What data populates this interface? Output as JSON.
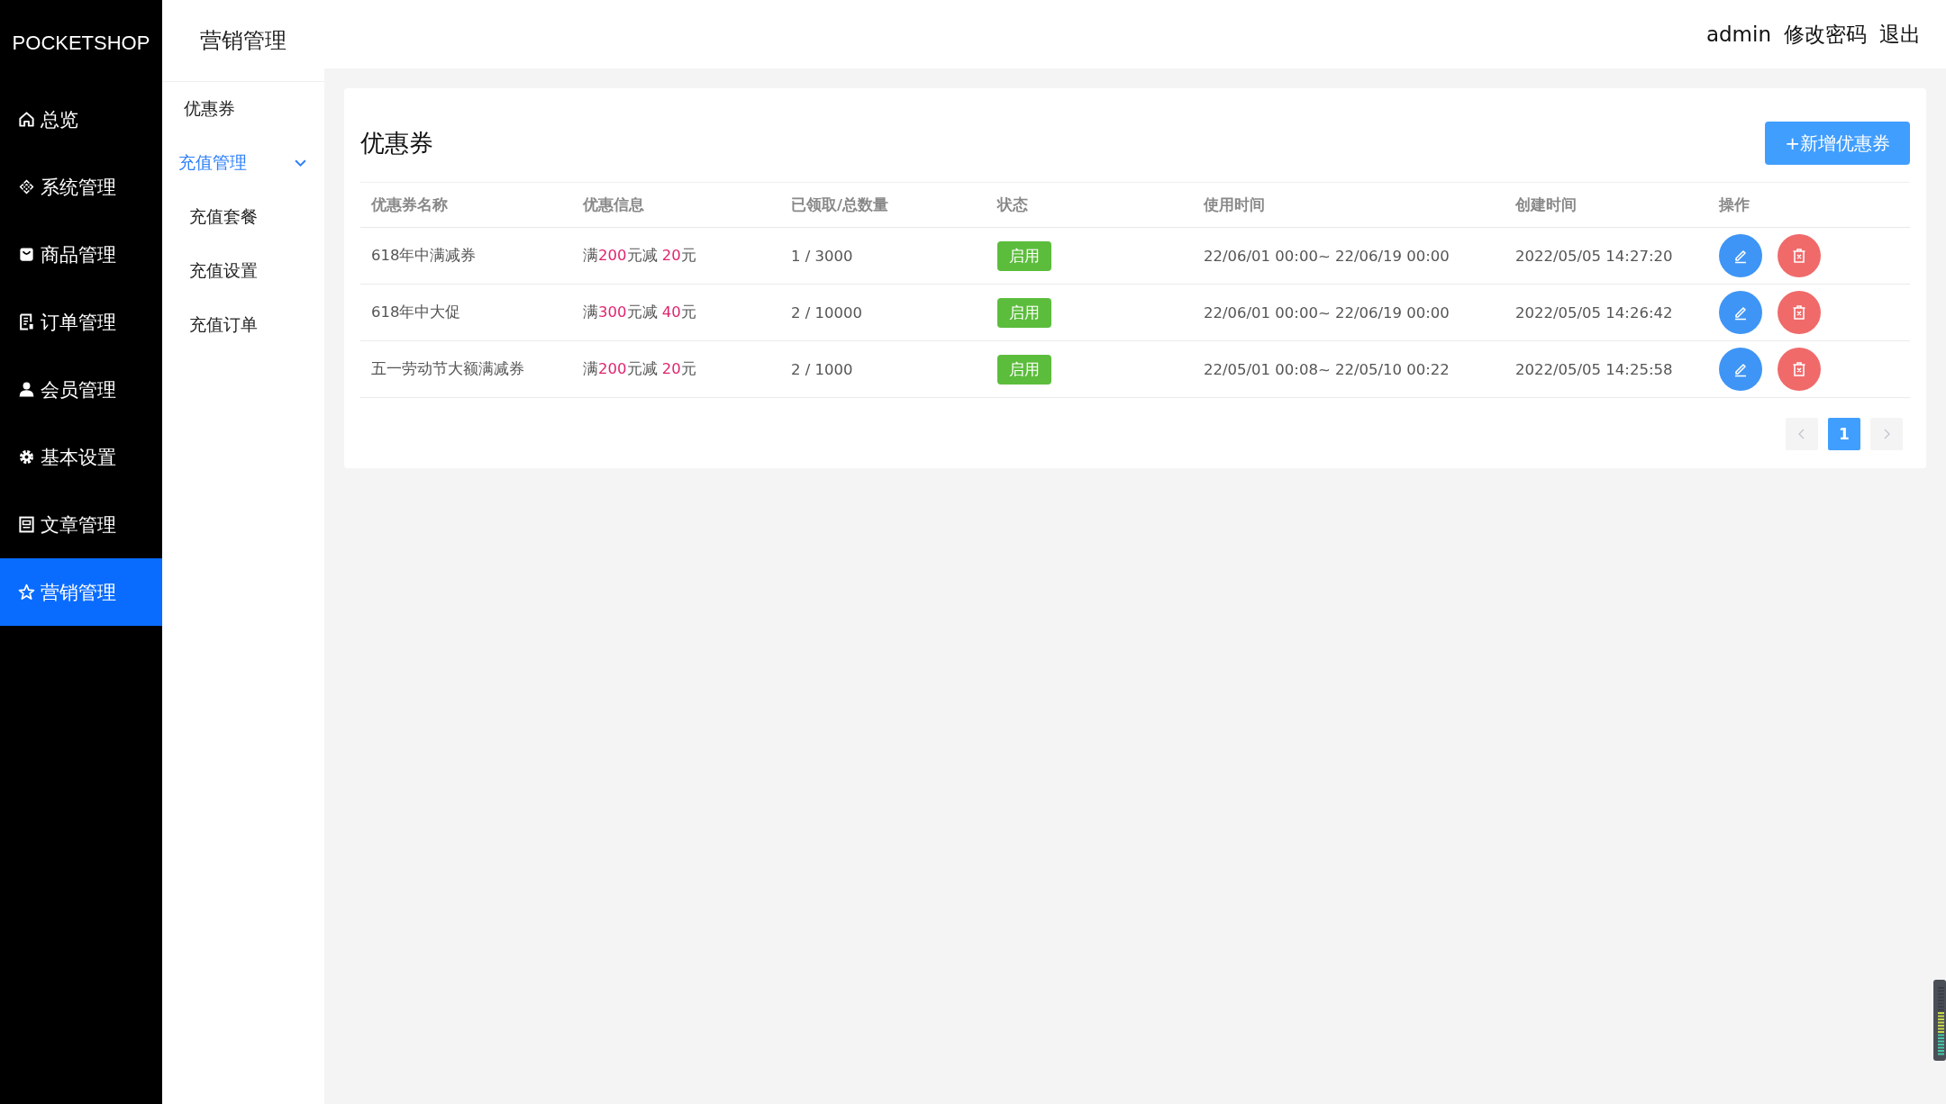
{
  "brand": "POCKETSHOP",
  "nav": [
    {
      "label": "总览",
      "selected": false
    },
    {
      "label": "系统管理",
      "selected": false
    },
    {
      "label": "商品管理",
      "selected": false
    },
    {
      "label": "订单管理",
      "selected": false
    },
    {
      "label": "会员管理",
      "selected": false
    },
    {
      "label": "基本设置",
      "selected": false
    },
    {
      "label": "文章管理",
      "selected": false
    },
    {
      "label": "营销管理",
      "selected": true
    }
  ],
  "submenu": {
    "title": "营销管理",
    "items": [
      {
        "label": "优惠券",
        "selected": false
      },
      {
        "label": "充值管理",
        "expanded": true,
        "children": [
          {
            "label": "充值套餐",
            "selected": false
          },
          {
            "label": "充值设置",
            "selected": false
          },
          {
            "label": "充值订单",
            "selected": false
          }
        ]
      }
    ]
  },
  "header": {
    "user": "admin",
    "links": [
      "修改密码",
      "退出"
    ]
  },
  "card": {
    "title": "优惠券",
    "add_button": "+新增优惠券",
    "table": {
      "columns": [
        "优惠券名称",
        "优惠信息",
        "已领取/总数量",
        "状态",
        "使用时间",
        "创建时间",
        "操作"
      ],
      "rows": [
        {
          "name": "618年中满减券",
          "info": [
            {
              "text": "满",
              "highlight": false
            },
            {
              "text": "200",
              "highlight": true
            },
            {
              "text": "元减 ",
              "highlight": false
            },
            {
              "text": "20",
              "highlight": true
            },
            {
              "text": "元",
              "highlight": false
            }
          ],
          "count": "1 / 3000",
          "status": {
            "label": "启用",
            "on": true
          },
          "period": "22/06/01 00:00~ 22/06/19 00:00",
          "created": "2022/05/05 14:27:20"
        },
        {
          "name": "618年中大促",
          "info": [
            {
              "text": "满",
              "highlight": false
            },
            {
              "text": "300",
              "highlight": true
            },
            {
              "text": "元减 ",
              "highlight": false
            },
            {
              "text": "40",
              "highlight": true
            },
            {
              "text": "元",
              "highlight": false
            }
          ],
          "count": "2 / 10000",
          "status": {
            "label": "启用",
            "on": true
          },
          "period": "22/06/01 00:00~ 22/06/19 00:00",
          "created": "2022/05/05 14:26:42"
        },
        {
          "name": "五一劳动节大额满减券",
          "info": [
            {
              "text": "满",
              "highlight": false
            },
            {
              "text": "200",
              "highlight": true
            },
            {
              "text": "元减 ",
              "highlight": false
            },
            {
              "text": "20",
              "highlight": true
            },
            {
              "text": "元",
              "highlight": false
            }
          ],
          "count": "2 / 1000",
          "status": {
            "label": "启用",
            "on": true
          },
          "period": "22/05/01 00:08~ 22/05/10 00:22",
          "created": "2022/05/05 14:25:58"
        }
      ]
    },
    "pagination": {
      "prev_disabled": true,
      "next_disabled": true,
      "pages": [
        {
          "label": "1",
          "selected": true
        }
      ]
    }
  }
}
